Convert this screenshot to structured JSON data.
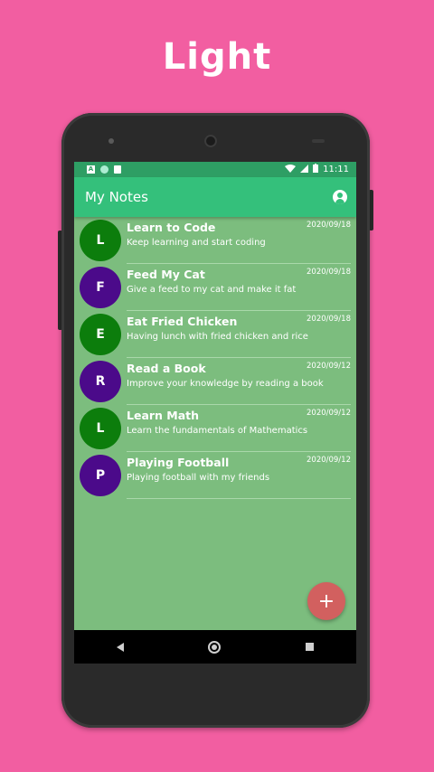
{
  "banner": {
    "label": "Light"
  },
  "status_bar": {
    "time": "11:11",
    "left_icon_text": "A"
  },
  "app_bar": {
    "title": "My Notes",
    "account_icon": "account-circle-icon"
  },
  "notes": [
    {
      "initial": "L",
      "title": "Learn to Code",
      "subtitle": "Keep learning and  start coding",
      "date": "2020/09/18",
      "color": "#0c7d0c"
    },
    {
      "initial": "F",
      "title": "Feed My Cat",
      "subtitle": "Give a feed to my cat and make it fat",
      "date": "2020/09/18",
      "color": "#4b0a8a"
    },
    {
      "initial": "E",
      "title": "Eat Fried Chicken",
      "subtitle": "Having lunch with fried chicken and rice",
      "date": "2020/09/18",
      "color": "#0c7d0c"
    },
    {
      "initial": "R",
      "title": "Read a Book",
      "subtitle": "Improve your knowledge by reading a book",
      "date": "2020/09/12",
      "color": "#4b0a8a"
    },
    {
      "initial": "L",
      "title": "Learn Math",
      "subtitle": "Learn the fundamentals of Mathematics",
      "date": "2020/09/12",
      "color": "#0c7d0c"
    },
    {
      "initial": "P",
      "title": "Playing Football",
      "subtitle": "Playing football with my friends",
      "date": "2020/09/12",
      "color": "#4b0a8a"
    }
  ],
  "fab": {
    "label": "+",
    "icon": "add-icon"
  },
  "colors": {
    "background": "#f25ea1",
    "app_bar": "#34c07b",
    "list_background": "#7cbd7e",
    "fab": "#d2605f"
  }
}
